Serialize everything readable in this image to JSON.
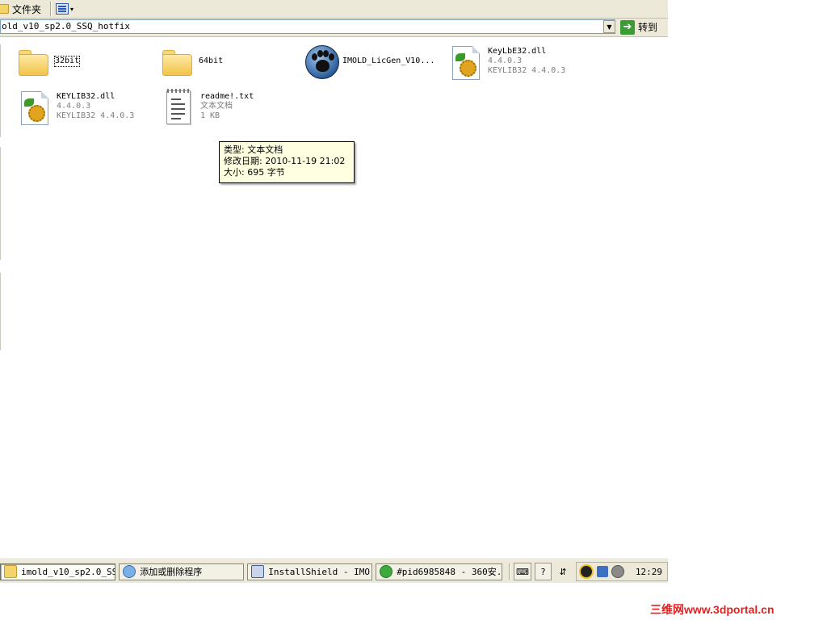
{
  "toolbar": {
    "folders_label": "文件夹",
    "views_chevron": "▾"
  },
  "address": {
    "value": "old_v10_sp2.0_SSQ_hotfix",
    "dropdown_glyph": "▼",
    "go_label": "转到",
    "go_glyph": "➔"
  },
  "files": [
    {
      "name": "32bit",
      "type": "folder"
    },
    {
      "name": "64bit",
      "type": "folder"
    },
    {
      "name": "IMOLD_LicGen_V10...",
      "type": "app"
    },
    {
      "name": "KeyLbE32.dll",
      "version": "4.4.0.3",
      "desc": "KEYLIB32 4.4.0.3",
      "type": "dll"
    },
    {
      "name": "KEYLIB32.dll",
      "version": "4.4.0.3",
      "desc": "KEYLIB32 4.4.0.3",
      "type": "dll"
    },
    {
      "name": "readme!.txt",
      "kind": "文本文档",
      "size": "1 KB",
      "type": "txt"
    }
  ],
  "tooltip": {
    "type_line": "类型: 文本文档",
    "date_line": "修改日期: 2010-11-19 21:02",
    "size_line": "大小: 695 字节"
  },
  "taskbar": {
    "tasks": [
      {
        "label": "imold_v10_sp2.0_SS...",
        "active": true
      },
      {
        "label": "添加或删除程序",
        "active": false
      },
      {
        "label": "InstallShield - IMO...",
        "active": false
      },
      {
        "label": "#pid6985848 - 360安...",
        "active": false
      }
    ],
    "keyboard_glyph": "⌨",
    "help_glyph": "?",
    "lang_glyph": "⇵",
    "clock": "12:29"
  },
  "watermark": "三维网www.3dportal.cn",
  "colors": {
    "watermark": "#e52121",
    "tooltip_bg": "#ffffe1",
    "go_green": "#3c9b34"
  }
}
